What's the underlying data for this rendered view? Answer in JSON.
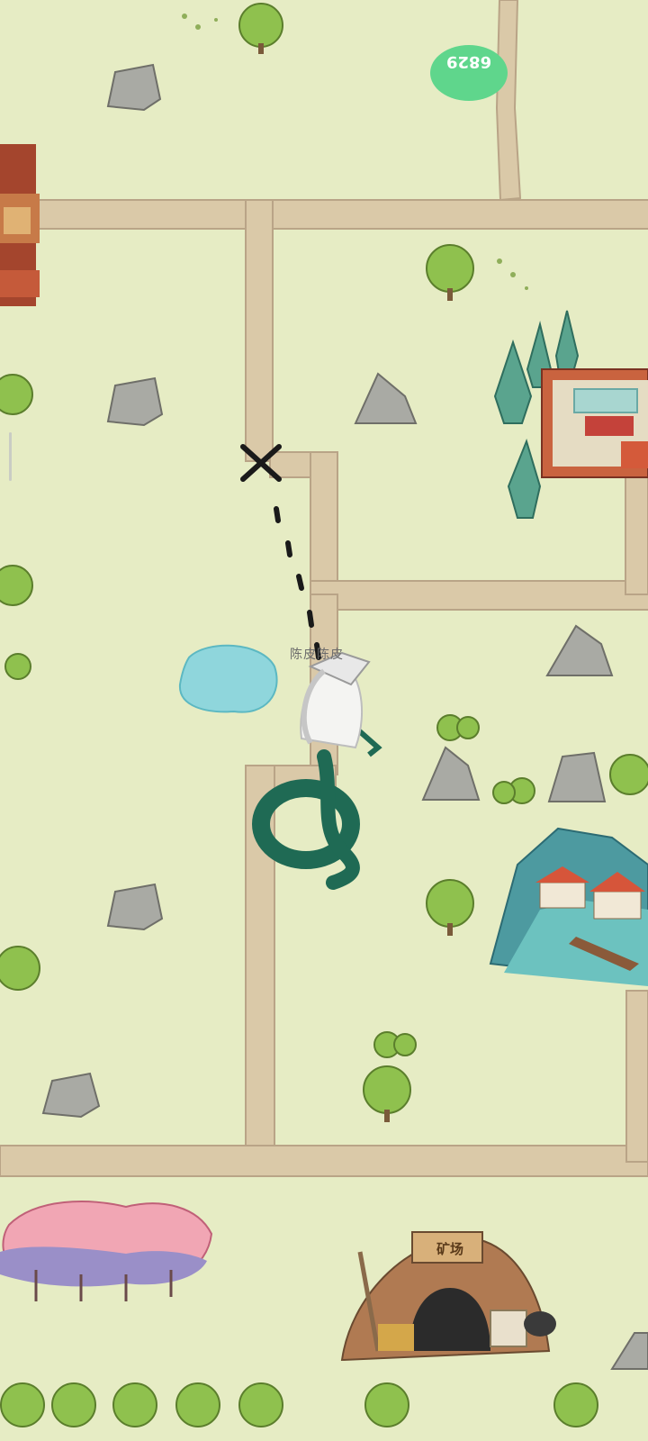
{
  "player": {
    "name": "陈皮陈皮"
  },
  "badge": {
    "value": "6829"
  },
  "locations": {
    "mine_sign": "矿场"
  },
  "icons": {
    "destination": "x-marker-icon",
    "path": "dotted-path-icon",
    "player": "snake-character-icon"
  },
  "colors": {
    "ground": "#e6ecc4",
    "road": "#d9c9aa",
    "badge": "#5fd68c"
  }
}
